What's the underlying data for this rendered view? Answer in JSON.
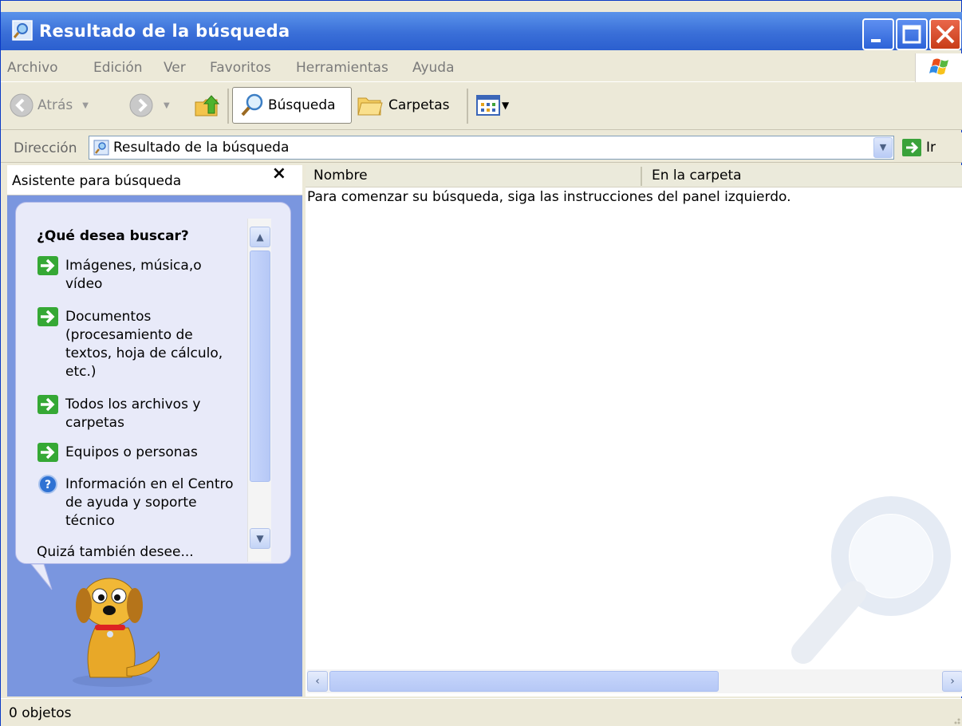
{
  "window": {
    "title": "Resultado de la búsqueda"
  },
  "menu": [
    "Archivo",
    "Edición",
    "Ver",
    "Favoritos",
    "Herramientas",
    "Ayuda"
  ],
  "toolbar": {
    "back": "Atrás",
    "search": "Búsqueda",
    "folders": "Carpetas"
  },
  "address": {
    "label": "Dirección",
    "value": "Resultado de la búsqueda",
    "go": "Ir"
  },
  "search_pane": {
    "title": "Asistente para búsqueda",
    "close": "×",
    "question": "¿Qué desea buscar?",
    "options": [
      {
        "label": "Imágenes, música,o vídeo",
        "icon": "green-arrow-icon"
      },
      {
        "label": "Documentos (procesamiento de textos, hoja de cálculo, etc.)",
        "icon": "green-arrow-icon"
      },
      {
        "label": "Todos los archivos y carpetas",
        "icon": "green-arrow-icon"
      },
      {
        "label": "Equipos o personas",
        "icon": "green-arrow-icon"
      },
      {
        "label": "Información en el Centro de ayuda y soporte técnico",
        "icon": "help-icon"
      }
    ],
    "more": "Quizá también desee..."
  },
  "results": {
    "columns": [
      "Nombre",
      "En la carpeta"
    ],
    "message": "Para comenzar su búsqueda, siga las instrucciones del panel izquierdo."
  },
  "status": {
    "text": "0 objetos"
  },
  "colors": {
    "titlebar": "#2b5fcf",
    "pane": "#7a96df",
    "bubble": "#e8eaf9"
  }
}
